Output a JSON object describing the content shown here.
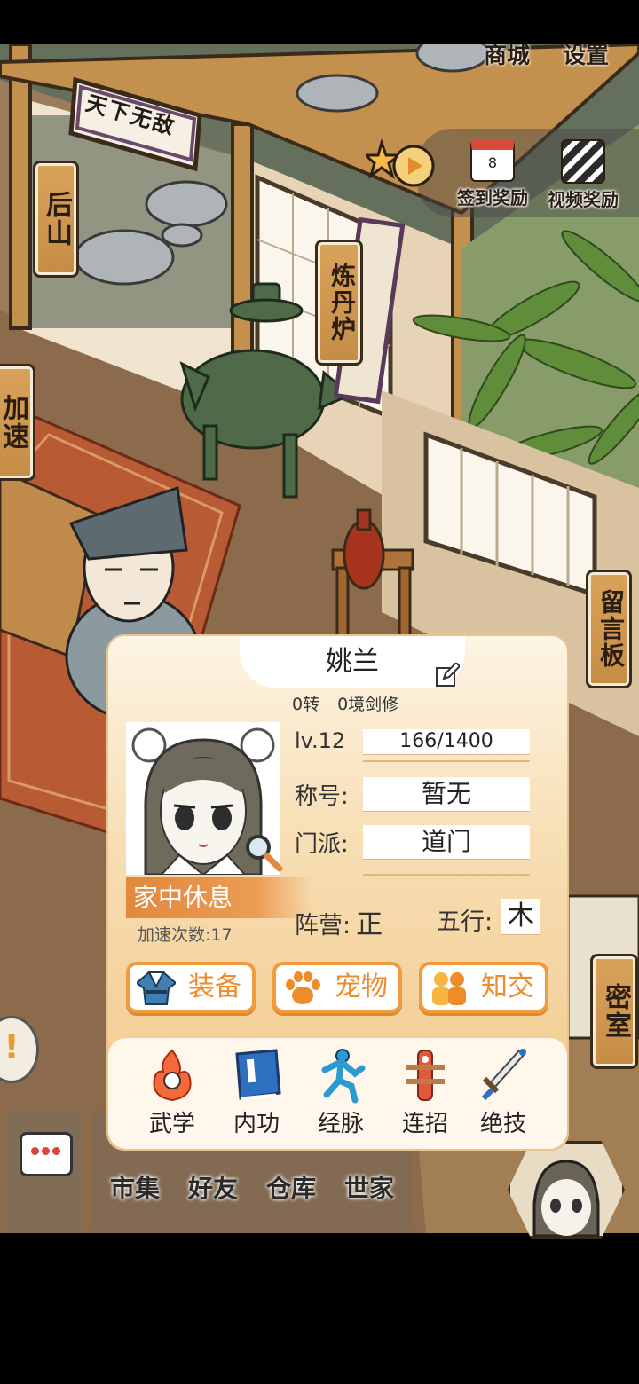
{
  "scene_signs": {
    "houshan": "后山",
    "jiasu": "加速",
    "liandanlu": "炼丹炉",
    "liuyanban": "留言板",
    "mishi": "密室",
    "tianxia": "天下无敌"
  },
  "top_menu": {
    "shop": "商城",
    "settings": "设置"
  },
  "rewards": {
    "checkin_label": "签到奖励",
    "checkin_day": "8",
    "video_label": "视频奖励"
  },
  "bottom_menu": {
    "market": "市集",
    "friends": "好友",
    "warehouse": "仓库",
    "family": "世家"
  },
  "character": {
    "name": "姚兰",
    "rebirth": "0转",
    "realm": "0境剑修",
    "level_label": "lv.12",
    "exp": "166/1400",
    "title_label": "称号:",
    "title_value": "暂无",
    "sect_label": "门派:",
    "sect_value": "道门",
    "status": "家中休息",
    "speedup_label": "加速次数:",
    "speedup_count": "17",
    "camp_label": "阵营:",
    "camp_value": "正",
    "element_label": "五行:",
    "element_value": "木"
  },
  "panel_buttons": {
    "equipment": "装备",
    "pet": "宠物",
    "friends": "知交"
  },
  "skills": [
    {
      "label": "武学",
      "icon": "fire-icon"
    },
    {
      "label": "内功",
      "icon": "book-icon"
    },
    {
      "label": "经脉",
      "icon": "meridian-figure-icon"
    },
    {
      "label": "连招",
      "icon": "training-dummy-icon"
    },
    {
      "label": "绝技",
      "icon": "sword-icon"
    }
  ],
  "colors": {
    "accent_orange": "#f19a3e",
    "panel_bg": "#f7deb4",
    "status_bar": "#e2883f"
  }
}
